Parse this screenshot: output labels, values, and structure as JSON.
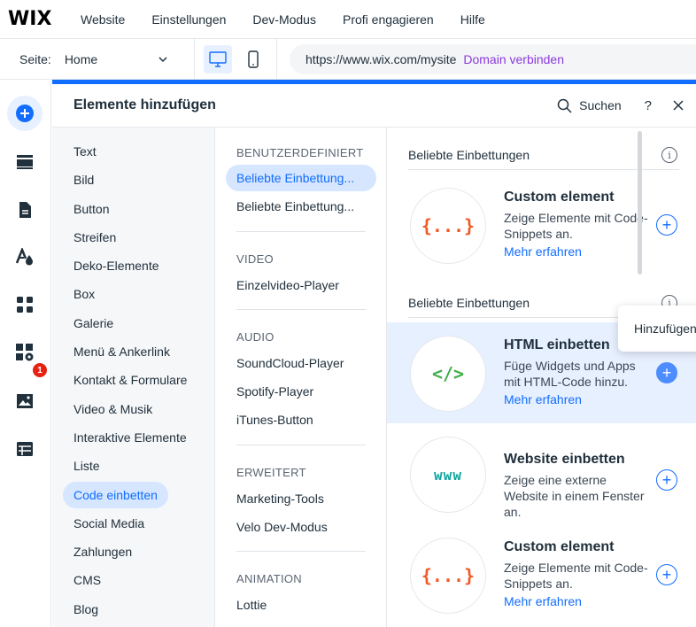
{
  "topbar": {
    "logo": "WIX",
    "menu": [
      "Website",
      "Einstellungen",
      "Dev-Modus",
      "Profi engagieren",
      "Hilfe"
    ]
  },
  "pagebar": {
    "page_label": "Seite:",
    "page_value": "Home",
    "url": "https://www.wix.com/mysite",
    "connect_domain": "Domain verbinden"
  },
  "rail": {
    "badge_count": "1"
  },
  "panel": {
    "title": "Elemente hinzufügen",
    "search_label": "Suchen",
    "help_label": "?",
    "categories": [
      "Text",
      "Bild",
      "Button",
      "Streifen",
      "Deko-Elemente",
      "Box",
      "Galerie",
      "Menü & Ankerlink",
      "Kontakt & Formulare",
      "Video & Musik",
      "Interaktive Elemente",
      "Liste",
      "Code einbetten",
      "Social Media",
      "Zahlungen",
      "CMS",
      "Blog"
    ],
    "active_category": "Code einbetten",
    "sections": {
      "custom": {
        "heading": "BENUTZERDEFINIERT",
        "items": [
          "Beliebte Einbettung...",
          "Beliebte Einbettung..."
        ]
      },
      "video": {
        "heading": "VIDEO",
        "items": [
          "Einzelvideo-Player"
        ]
      },
      "audio": {
        "heading": "AUDIO",
        "items": [
          "SoundCloud-Player",
          "Spotify-Player",
          "iTunes-Button"
        ]
      },
      "advanced": {
        "heading": "ERWEITERT",
        "items": [
          "Marketing-Tools",
          "Velo Dev-Modus"
        ]
      },
      "animation": {
        "heading": "ANIMATION",
        "items": [
          "Lottie"
        ]
      }
    },
    "groups": [
      {
        "heading": "Beliebte Einbettungen",
        "info": "i"
      },
      {
        "heading": "Beliebte Einbettungen",
        "info": "i"
      }
    ],
    "items": [
      {
        "icon_text": "{...}",
        "title": "Custom element",
        "desc": "Zeige Elemente mit Code-Snippets an.",
        "link": "Mehr erfahren"
      },
      {
        "icon_text": "</>",
        "title": "HTML einbetten",
        "desc": "Füge Widgets und Apps mit HTML-Code hinzu.",
        "link": "Mehr erfahren"
      },
      {
        "icon_text": "www",
        "title": "Website einbetten",
        "desc": "Zeige eine externe Website in einem Fenster an."
      },
      {
        "icon_text": "{...}",
        "title": "Custom element",
        "desc": "Zeige Elemente mit Code-Snippets an.",
        "link": "Mehr erfahren"
      }
    ],
    "tooltip": "Hinzufügen"
  },
  "colors": {
    "accent": "#116dff",
    "accent_light": "#e7f0ff",
    "domain_link": "#8a39de",
    "badge": "#e62214",
    "icon_orange": "#f05a24",
    "icon_green": "#3fae49",
    "icon_teal": "#11a5a0"
  }
}
